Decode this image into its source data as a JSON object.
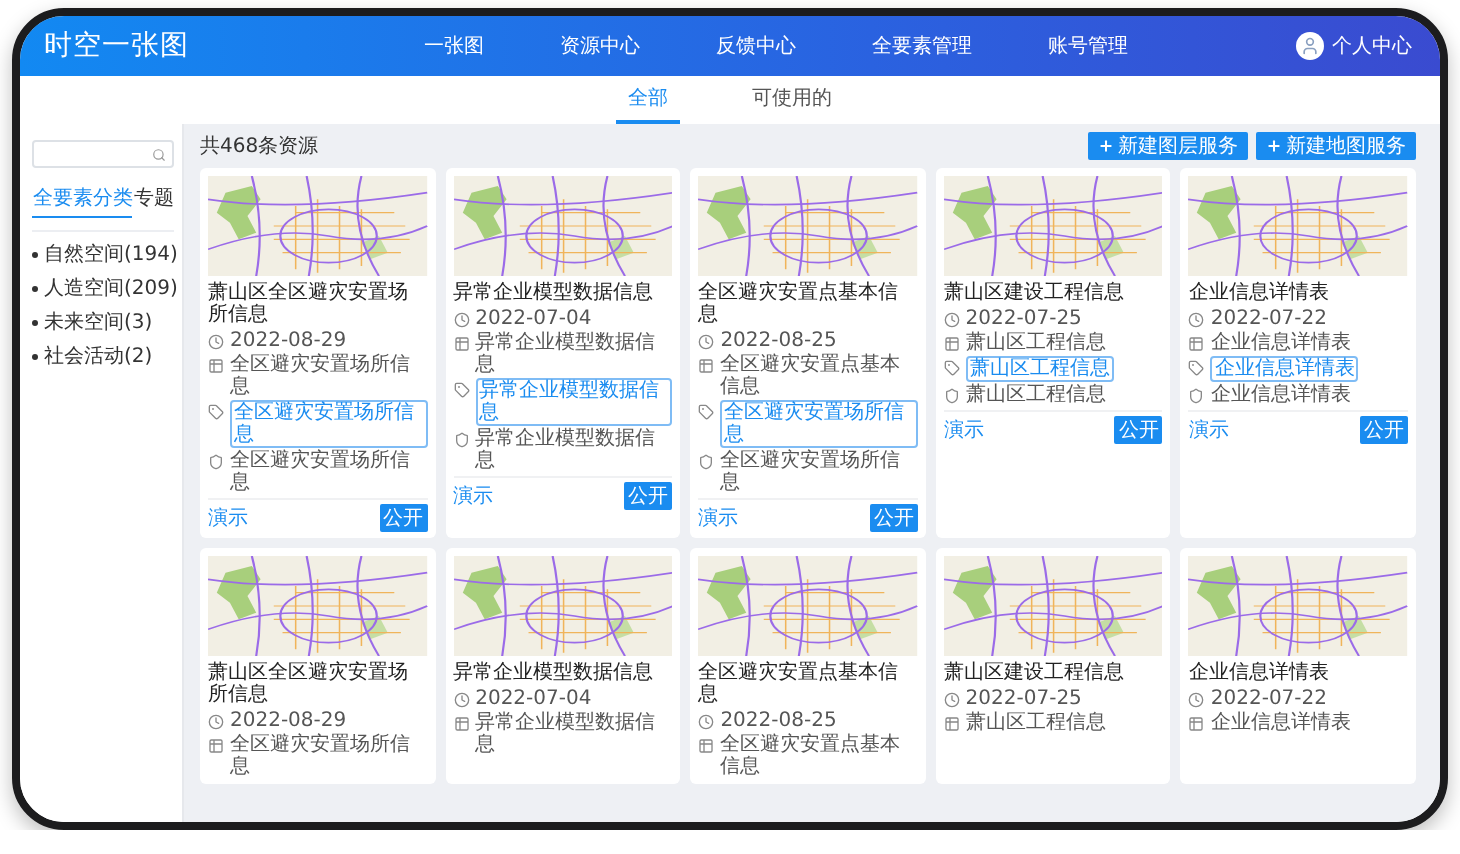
{
  "header": {
    "logo": "时空一张图",
    "nav": [
      {
        "label": "一张图"
      },
      {
        "label": "资源中心"
      },
      {
        "label": "反馈中心"
      },
      {
        "label": "全要素管理"
      },
      {
        "label": "账号管理"
      }
    ],
    "user": "个人中心"
  },
  "tabs": [
    {
      "label": "全部",
      "selected": true
    },
    {
      "label": "可使用的",
      "selected": false
    }
  ],
  "sidebar": {
    "tabs": [
      {
        "label": "全要素分类",
        "selected": true
      },
      {
        "label": "专题",
        "selected": false
      }
    ],
    "items": [
      {
        "label": "自然空间(194)"
      },
      {
        "label": "人造空间(209)"
      },
      {
        "label": "未来空间(3)"
      },
      {
        "label": "社会活动(2)"
      }
    ]
  },
  "toolbar": {
    "count": "共468条资源",
    "buttons": [
      "新建图层服务",
      "新建地图服务"
    ]
  },
  "cards": [
    {
      "title": "萧山区全区避灾安置场所信息",
      "rows": [
        {
          "kind": "date",
          "text": "2022-08-29"
        },
        {
          "kind": "category",
          "text": "全区避灾安置场所信息"
        },
        {
          "kind": "tag",
          "text": "全区避灾安置场所信息"
        },
        {
          "kind": "source",
          "text": "全区避灾安置场所信息"
        }
      ],
      "footer": {
        "link": "演示",
        "badge": "公开"
      }
    },
    {
      "title": "异常企业模型数据信息",
      "rows": [
        {
          "kind": "date",
          "text": "2022-07-04"
        },
        {
          "kind": "category",
          "text": "异常企业模型数据信息"
        },
        {
          "kind": "tag",
          "text": "异常企业模型数据信息"
        },
        {
          "kind": "source",
          "text": "异常企业模型数据信息"
        }
      ],
      "footer": {
        "link": "演示",
        "badge": "公开"
      }
    },
    {
      "title": "全区避灾安置点基本信息",
      "rows": [
        {
          "kind": "date",
          "text": "2022-08-25"
        },
        {
          "kind": "category",
          "text": "全区避灾安置点基本信息"
        },
        {
          "kind": "tag",
          "text": "全区避灾安置场所信息"
        },
        {
          "kind": "source",
          "text": "全区避灾安置场所信息"
        }
      ],
      "footer": {
        "link": "演示",
        "badge": "公开"
      }
    },
    {
      "title": "萧山区建设工程信息",
      "rows": [
        {
          "kind": "date",
          "text": "2022-07-25"
        },
        {
          "kind": "category",
          "text": "萧山区工程信息"
        },
        {
          "kind": "tag",
          "text": "萧山区工程信息"
        },
        {
          "kind": "source",
          "text": "萧山区工程信息"
        }
      ],
      "footer": {
        "link": "演示",
        "badge": "公开"
      }
    },
    {
      "title": "企业信息详情表",
      "rows": [
        {
          "kind": "date",
          "text": "2022-07-22"
        },
        {
          "kind": "category",
          "text": "企业信息详情表"
        },
        {
          "kind": "tag",
          "text": "企业信息详情表"
        },
        {
          "kind": "source",
          "text": "企业信息详情表"
        }
      ],
      "footer": {
        "link": "演示",
        "badge": "公开"
      }
    },
    {
      "title": "萧山区全区避灾安置场所信息",
      "rows": [
        {
          "kind": "date",
          "text": "2022-08-29"
        },
        {
          "kind": "category",
          "text": "全区避灾安置场所信息"
        }
      ]
    },
    {
      "title": "异常企业模型数据信息",
      "rows": [
        {
          "kind": "date",
          "text": "2022-07-04"
        },
        {
          "kind": "category",
          "text": "异常企业模型数据信息"
        }
      ]
    },
    {
      "title": "全区避灾安置点基本信息",
      "rows": [
        {
          "kind": "date",
          "text": "2022-08-25"
        },
        {
          "kind": "category",
          "text": "全区避灾安置点基本信息"
        }
      ]
    },
    {
      "title": "萧山区建设工程信息",
      "rows": [
        {
          "kind": "date",
          "text": "2022-07-25"
        },
        {
          "kind": "category",
          "text": "萧山区工程信息"
        }
      ]
    },
    {
      "title": "企业信息详情表",
      "rows": [
        {
          "kind": "date",
          "text": "2022-07-22"
        },
        {
          "kind": "category",
          "text": "企业信息详情表"
        }
      ]
    }
  ]
}
